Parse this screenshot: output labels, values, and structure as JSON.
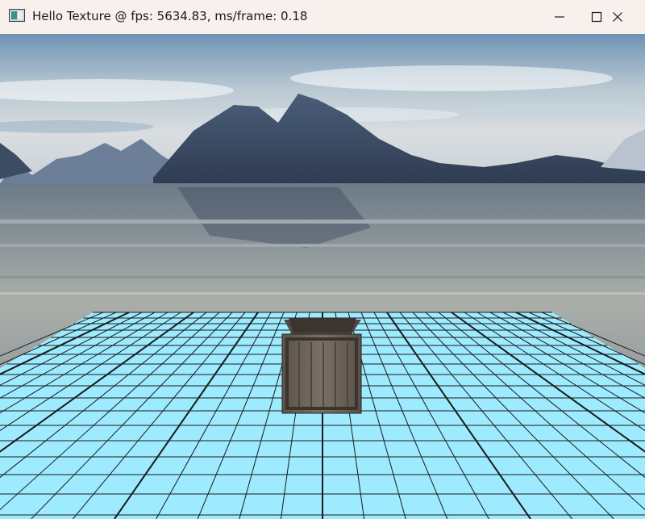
{
  "window": {
    "title": "Hello Texture @ fps: 5634.83, ms/frame: 0.18",
    "icon": "app-window-icon",
    "controls": [
      "minimize-icon",
      "maximize-icon",
      "close-icon"
    ]
  },
  "scene": {
    "skybox": "lake-mountains",
    "floor": {
      "pattern": "grid",
      "color": "#9eeaff",
      "line_color": "#1a1a1a"
    },
    "object": "wooden-crate"
  },
  "colors": {
    "titlebar_bg": "#f7f0ec",
    "sky_top": "#6f93b5",
    "water": "#8a97a0",
    "floor": "#9eeaff",
    "crate": "#6b6158"
  }
}
